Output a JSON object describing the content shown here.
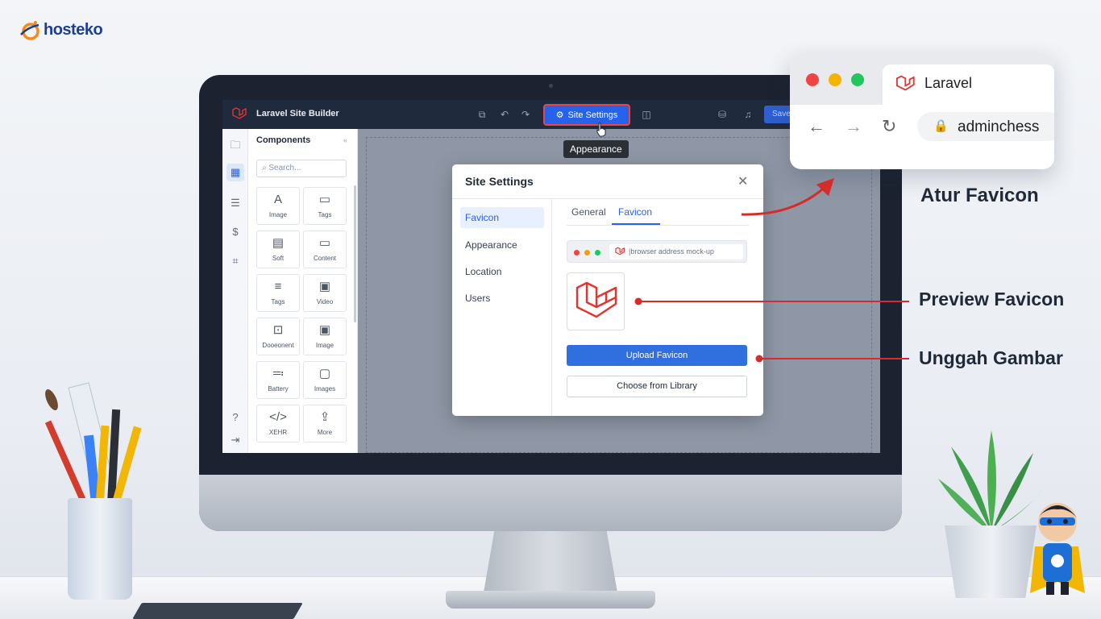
{
  "brand": {
    "name": "hosteko"
  },
  "app": {
    "title": "Laravel Site Builder",
    "site_settings_label": "Site Settings",
    "save_label": "Save",
    "tooltip": "Appearance"
  },
  "panel": {
    "title": "Components",
    "search_placeholder": "Search...",
    "components": [
      {
        "label": "Image",
        "icon": "letter-a-icon"
      },
      {
        "label": "Tags",
        "icon": "tag-box-icon"
      },
      {
        "label": "Soft",
        "icon": "grid-icon"
      },
      {
        "label": "Content",
        "icon": "content-icon"
      },
      {
        "label": "Tags",
        "icon": "lines-icon"
      },
      {
        "label": "Video",
        "icon": "picture-icon"
      },
      {
        "label": "Dooeonent",
        "icon": "document-icon"
      },
      {
        "label": "Image",
        "icon": "image-icon"
      },
      {
        "label": "Battery",
        "icon": "battery-icon"
      },
      {
        "label": "Images",
        "icon": "images-icon"
      },
      {
        "label": "XEHR",
        "icon": "code-icon"
      },
      {
        "label": "More",
        "icon": "upload-icon"
      }
    ]
  },
  "modal": {
    "title": "Site Settings",
    "sidebar": [
      "Favicon",
      "Appearance",
      "Location",
      "Users"
    ],
    "active_sidebar": "Favicon",
    "tabs": [
      "General",
      "Favicon"
    ],
    "active_tab": "Favicon",
    "mock_address": "|browser address mock-up",
    "upload_label": "Upload Favicon",
    "library_label": "Choose from Library"
  },
  "browser": {
    "tab_label": "Laravel",
    "address": "adminchess"
  },
  "annotations": {
    "atur_favicon": "Atur Favicon",
    "preview_favicon": "Preview Favicon",
    "unggah_gambar": "Unggah Gambar"
  },
  "colors": {
    "accent": "#2563eb",
    "highlight": "#ef4444",
    "laravel": "#e3342f",
    "annotation_line": "#d62b2b"
  }
}
